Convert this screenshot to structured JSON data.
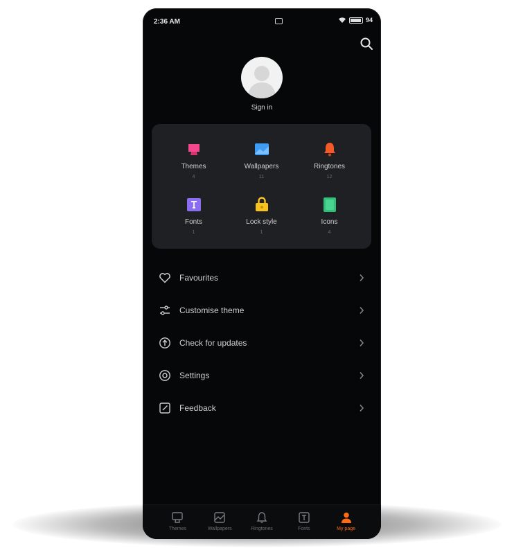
{
  "status_bar": {
    "time": "2:36 AM",
    "battery": "94"
  },
  "profile": {
    "sign_in": "Sign in"
  },
  "grid": [
    {
      "label": "Themes",
      "count": "4",
      "icon": "themes-icon",
      "color": "#f5478d"
    },
    {
      "label": "Wallpapers",
      "count": "11",
      "icon": "wallpapers-icon",
      "color": "#3d9df5"
    },
    {
      "label": "Ringtones",
      "count": "12",
      "icon": "ringtones-icon",
      "color": "#f25a2a"
    },
    {
      "label": "Fonts",
      "count": "1",
      "icon": "fonts-icon",
      "color": "#8a6df0"
    },
    {
      "label": "Lock style",
      "count": "1",
      "icon": "lock-style-icon",
      "color": "#f7c21b"
    },
    {
      "label": "Icons",
      "count": "4",
      "icon": "icons-icon",
      "color": "#2fbf78"
    }
  ],
  "menu": [
    {
      "label": "Favourites",
      "icon": "heart-icon"
    },
    {
      "label": "Customise theme",
      "icon": "sliders-icon"
    },
    {
      "label": "Check for updates",
      "icon": "update-icon"
    },
    {
      "label": "Settings",
      "icon": "settings-icon"
    },
    {
      "label": "Feedback",
      "icon": "feedback-icon"
    }
  ],
  "tabs": [
    {
      "label": "Themes",
      "icon": "themes-tab-icon",
      "active": false
    },
    {
      "label": "Wallpapers",
      "icon": "wallpapers-tab-icon",
      "active": false
    },
    {
      "label": "Ringtones",
      "icon": "ringtones-tab-icon",
      "active": false
    },
    {
      "label": "Fonts",
      "icon": "fonts-tab-icon",
      "active": false
    },
    {
      "label": "My page",
      "icon": "my-page-tab-icon",
      "active": true
    }
  ],
  "colors": {
    "accent": "#ff6a13",
    "background": "#060708",
    "card": "#1f2023"
  }
}
